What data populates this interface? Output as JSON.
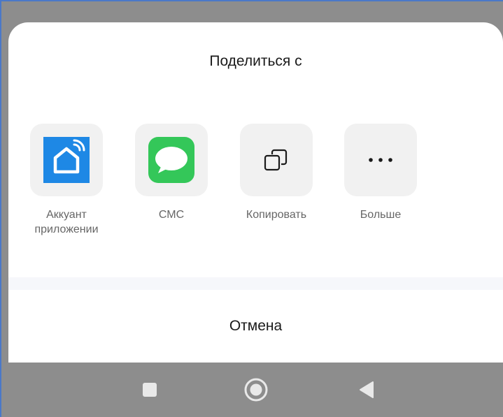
{
  "share_sheet": {
    "title": "Поделиться с",
    "options": [
      {
        "label": "Аккуант\nприложении",
        "icon": "smart-home-app-icon"
      },
      {
        "label": "СМС",
        "icon": "message-bubble-icon"
      },
      {
        "label": "Копировать",
        "icon": "copy-icon"
      },
      {
        "label": "Больше",
        "icon": "more-dots-icon"
      }
    ],
    "cancel_label": "Отмена"
  },
  "nav_bar": {
    "buttons": [
      {
        "icon": "recents-square-icon"
      },
      {
        "icon": "home-circle-icon"
      },
      {
        "icon": "back-triangle-icon"
      }
    ]
  },
  "colors": {
    "app_icon_blue": "#1e88e5",
    "sms_green": "#34c759",
    "overlay_gray": "#8d8d8d"
  }
}
